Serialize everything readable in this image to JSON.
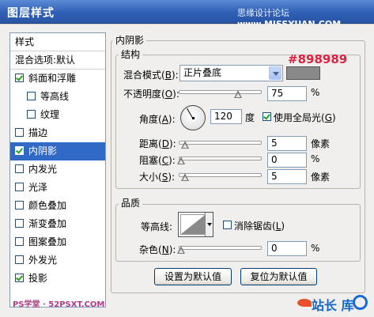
{
  "window": {
    "title": "图层样式",
    "watermark_cn": "思缘设计论坛",
    "watermark_url": "www.MISSYUAN.COM"
  },
  "sidebar": {
    "header": "样式",
    "blend_options": "混合选项:默认",
    "items": [
      {
        "label": "斜面和浮雕",
        "checked": true,
        "indent": false,
        "selected": false
      },
      {
        "label": "等高线",
        "checked": false,
        "indent": true,
        "selected": false
      },
      {
        "label": "纹理",
        "checked": false,
        "indent": true,
        "selected": false
      },
      {
        "label": "描边",
        "checked": false,
        "indent": false,
        "selected": false
      },
      {
        "label": "内阴影",
        "checked": true,
        "indent": false,
        "selected": true
      },
      {
        "label": "内发光",
        "checked": false,
        "indent": false,
        "selected": false
      },
      {
        "label": "光泽",
        "checked": false,
        "indent": false,
        "selected": false
      },
      {
        "label": "颜色叠加",
        "checked": false,
        "indent": false,
        "selected": false
      },
      {
        "label": "渐变叠加",
        "checked": false,
        "indent": false,
        "selected": false
      },
      {
        "label": "图案叠加",
        "checked": false,
        "indent": false,
        "selected": false
      },
      {
        "label": "外发光",
        "checked": false,
        "indent": false,
        "selected": false
      },
      {
        "label": "投影",
        "checked": true,
        "indent": false,
        "selected": false
      }
    ]
  },
  "inner_shadow": {
    "title": "内阴影",
    "structure": {
      "title": "结构",
      "blend_mode_label": "混合模式",
      "blend_mode_key": "B",
      "blend_mode_value": "正片叠底",
      "color_hex": "#898989",
      "opacity_label": "不透明度",
      "opacity_key": "O",
      "opacity_value": "75",
      "opacity_fraction": 0.75,
      "percent": "%",
      "angle_label": "角度",
      "angle_key": "A",
      "angle_value": "120",
      "angle_unit": "度",
      "global_light_label": "使用全局光",
      "global_light_key": "G",
      "global_light_checked": true,
      "distance_label": "距离",
      "distance_key": "D",
      "distance_value": "5",
      "px_unit": "像素",
      "choke_label": "阻塞",
      "choke_key": "C",
      "choke_value": "0",
      "size_label": "大小",
      "size_key": "S",
      "size_value": "5"
    },
    "quality": {
      "title": "品质",
      "contour_label": "等高线:",
      "antialias_label": "消除锯齿",
      "antialias_key": "L",
      "antialias_checked": false,
      "noise_label": "杂色",
      "noise_key": "N",
      "noise_value": "0"
    },
    "buttons": {
      "set_default": "设置为默认值",
      "reset_default": "复位为默认值"
    }
  },
  "footer": {
    "left_watermark": "PS学堂 · 52PSXT.COM",
    "brand": "站长",
    "brand_end": "库"
  }
}
